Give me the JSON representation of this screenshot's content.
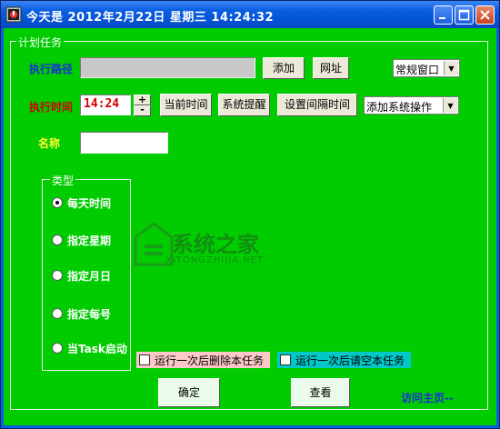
{
  "window": {
    "title": "今天是  2012年2月22日  星期三  14:24:32",
    "controls": [
      "minimize-icon",
      "maximize-icon",
      "close-icon"
    ]
  },
  "group_main": {
    "legend": "计划任务"
  },
  "exec_path": {
    "label": "执行路径",
    "value": "",
    "add_label": "添加",
    "url_label": "网址"
  },
  "window_mode": {
    "selected": "常规窗口"
  },
  "exec_time": {
    "label": "执行时间",
    "value": "14:24",
    "spin_up": "+",
    "spin_down": "-",
    "current_time_label": "当前时间",
    "system_reminder_label": "系统提醒",
    "set_interval_label": "设置间隔时间"
  },
  "system_action": {
    "selected": "添加系统操作"
  },
  "name_field": {
    "label": "名称",
    "value": ""
  },
  "type_group": {
    "legend": "类型",
    "options": [
      "每天时间",
      "指定星期",
      "指定月日",
      "指定每号",
      "当Task启动"
    ],
    "selected_index": 0
  },
  "checkbox_delete": {
    "label": "运行一次后删除本任务",
    "checked": false,
    "bg": "#ffc8c8"
  },
  "checkbox_clear": {
    "label": "运行一次后请空本任务",
    "checked": false,
    "bg": "#00c8c8"
  },
  "buttons": {
    "ok": "确定",
    "view": "查看"
  },
  "homepage_link": "访问主页--",
  "watermark": {
    "title": "系统之家",
    "subtitle": "XITONGZHIJIA.NET"
  },
  "colors": {
    "background": "#00cc00",
    "titlebar": "#0a5fe0",
    "label_blue": "#1a2fd8",
    "label_red": "#d00000",
    "label_yellow": "#ffff33",
    "time_text": "#d00000"
  }
}
